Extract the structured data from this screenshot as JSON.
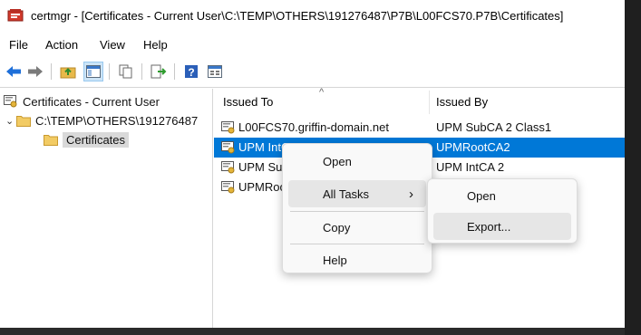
{
  "window": {
    "title": "certmgr - [Certificates - Current User\\C:\\TEMP\\OTHERS\\191276487\\P7B\\L00FCS70.P7B\\Certificates]"
  },
  "menu": [
    "File",
    "Action",
    "View",
    "Help"
  ],
  "toolbar": {
    "buttons": [
      "back-arrow-icon",
      "forward-arrow-icon",
      "up-folder-icon",
      "show-hide-tree-icon",
      "copy-icon",
      "export-list-icon",
      "help-icon",
      "properties-icon"
    ]
  },
  "tree": {
    "root": "Certificates - Current User",
    "child": "C:\\TEMP\\OTHERS\\191276487",
    "leaf": "Certificates"
  },
  "list": {
    "columns": [
      "Issued To",
      "Issued By"
    ],
    "sort_glyph": "^",
    "rows": [
      {
        "issued_to": "L00FCS70.griffin-domain.net",
        "issued_by": "UPM SubCA 2 Class1"
      },
      {
        "issued_to": "UPM IntCA 2",
        "issued_by": "UPMRootCA2"
      },
      {
        "issued_to": "UPM SubCA 2 Class1",
        "issued_by": "UPM IntCA 2"
      },
      {
        "issued_to": "UPMRootCA2",
        "issued_by": ""
      }
    ],
    "selected_row": 1
  },
  "context_menu": {
    "items": [
      "Open",
      "All Tasks",
      "Copy",
      "Help"
    ],
    "submenu_arrow": "›"
  },
  "submenu": {
    "items": [
      "Open",
      "Export..."
    ]
  },
  "colors": {
    "selection": "#0078d7",
    "menu_bg": "#f9f9f9",
    "hover": "#e6e6e6"
  }
}
